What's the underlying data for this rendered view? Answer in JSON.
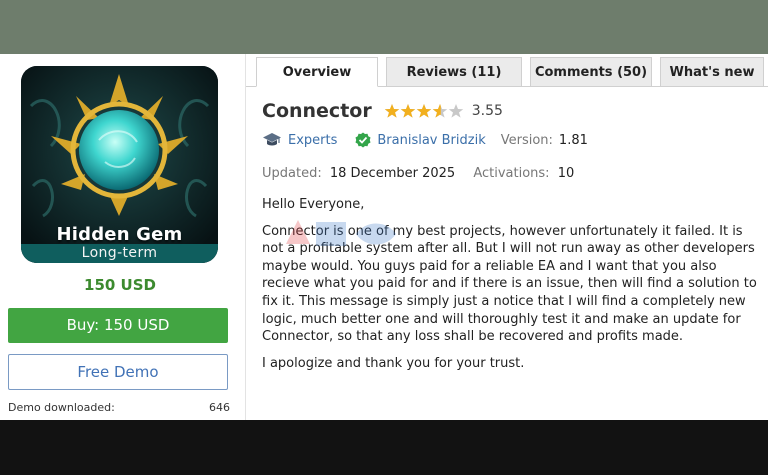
{
  "product": {
    "image_title": "Hidden Gem",
    "image_subtitle": "Long-term",
    "price": "150 USD",
    "buy_label": "Buy: 150 USD",
    "demo_label": "Free Demo",
    "demo_downloaded_label": "Demo downloaded:",
    "demo_downloaded_count": "646"
  },
  "tabs": [
    {
      "label": "Overview",
      "active": true
    },
    {
      "label": "Reviews (11)",
      "active": false
    },
    {
      "label": "Comments (50)",
      "active": false
    },
    {
      "label": "What's new",
      "active": false
    }
  ],
  "main": {
    "title": "Connector",
    "rating": "3.55",
    "rating_value": 3.55,
    "rating_max": 5,
    "category": "Experts",
    "author": "Branislav Bridzik",
    "version_label": "Version:",
    "version": "1.81",
    "updated_label": "Updated:",
    "updated": "18 December 2025",
    "activations_label": "Activations:",
    "activations": "10",
    "paragraphs": [
      "Hello Everyone,",
      "Connector is one of my best projects, however unfortunately it failed. It is not a profitable system after all. But I will not run away as other developers maybe would. You guys paid for a reliable EA and I want that you also recieve what you paid for and if there is an issue, then will find a solution to fix it. This message is simply just a notice that I will find a completely new logic, much better one and will thoroughly test it and make an update for Connector, so that any loss shall be recovered and profits made.",
      "I apologize and thank you for your trust."
    ]
  },
  "colors": {
    "accent_green": "#42a542",
    "link_blue": "#3b6fa9",
    "star_gold": "#f2b01e",
    "teal": "#0f5e5e"
  },
  "icons": {
    "category": "graduation-cap-icon",
    "author": "verified-check-icon",
    "rating": "star-icon"
  }
}
